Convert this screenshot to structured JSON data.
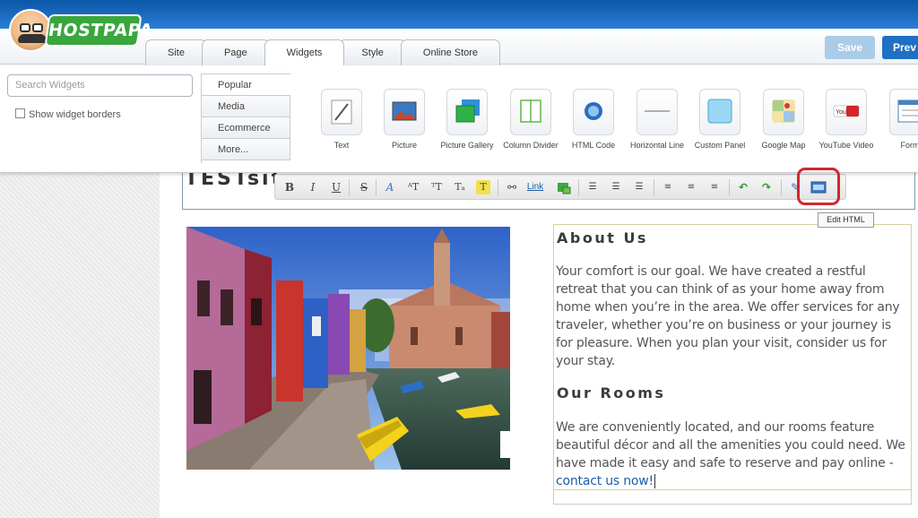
{
  "brand": {
    "name": "HOSTPAPA",
    "colors": {
      "header_blue": "#1f6fc3",
      "logo_green": "#3aa63e",
      "highlight_red": "#d3262b"
    }
  },
  "tabs": [
    {
      "label": "Site"
    },
    {
      "label": "Page"
    },
    {
      "label": "Widgets",
      "active": true
    },
    {
      "label": "Style"
    },
    {
      "label": "Online Store"
    }
  ],
  "header": {
    "save_label": "Save",
    "preview_label": "Prev"
  },
  "panel": {
    "search_placeholder": "Search Widgets",
    "show_borders_label": "Show widget borders",
    "categories": [
      "Popular",
      "Media",
      "Ecommerce",
      "More..."
    ],
    "widgets": [
      {
        "label": "Text",
        "icon": "text-widget-icon"
      },
      {
        "label": "Picture",
        "icon": "picture-widget-icon"
      },
      {
        "label": "Picture Gallery",
        "icon": "gallery-widget-icon"
      },
      {
        "label": "Column Divider",
        "icon": "column-divider-icon"
      },
      {
        "label": "HTML Code",
        "icon": "html-code-icon"
      },
      {
        "label": "Horizontal Line",
        "icon": "horizontal-line-icon"
      },
      {
        "label": "Custom Panel",
        "icon": "custom-panel-icon"
      },
      {
        "label": "Google Map",
        "icon": "google-map-icon"
      },
      {
        "label": "YouTube Video",
        "icon": "youtube-icon"
      },
      {
        "label": "Form",
        "icon": "form-icon"
      }
    ]
  },
  "editor": {
    "site_title": "TESTsit",
    "toolbar": {
      "bold": "B",
      "italic": "I",
      "underline": "U",
      "strike": "S",
      "link_label": "Link",
      "tooltip": "Edit HTML"
    },
    "about": {
      "heading": "About Us",
      "body": "Your comfort is our goal. We have created a restful retreat that you can think of as your home away from home when you’re in the area. We offer services for any traveler, whether you’re on business or your journey is for pleasure. When you plan your visit, consider us for your stay."
    },
    "rooms": {
      "heading": "Our Rooms",
      "body": "We are conveniently located, and our rooms feature beautiful décor and all the amenities you could need. We have made it easy and safe to reserve and pay online - ",
      "link": "contact us now!"
    }
  }
}
